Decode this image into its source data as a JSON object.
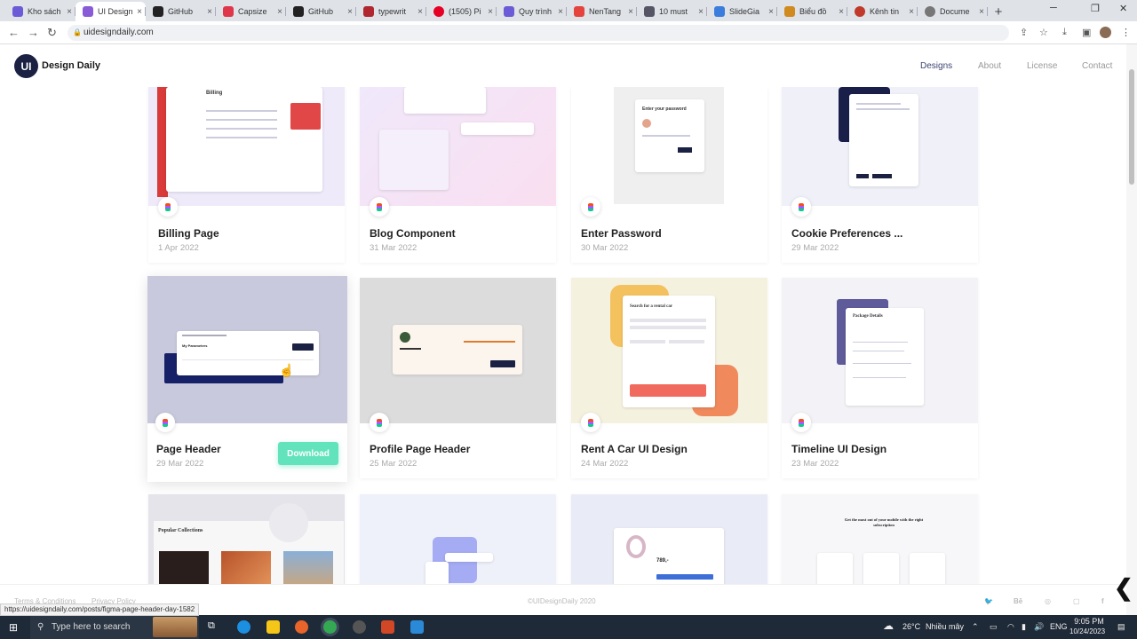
{
  "browser": {
    "tabs": [
      {
        "label": "Kho sách",
        "color": "#6b5bd6"
      },
      {
        "label": "UI Design",
        "color": "#8a5bd6"
      },
      {
        "label": "GitHub",
        "color": "#222222"
      },
      {
        "label": "Capsize",
        "color": "#e0364b"
      },
      {
        "label": "GitHub",
        "color": "#222222"
      },
      {
        "label": "typewrit",
        "color": "#b0272f"
      },
      {
        "label": "(1505) Pi",
        "color": "#e60023"
      },
      {
        "label": "Quy trình",
        "color": "#6b5bd6"
      },
      {
        "label": "NenTang",
        "color": "#e5433d"
      },
      {
        "label": "10 must",
        "color": "#555566"
      },
      {
        "label": "SlideGia",
        "color": "#3b7ddd"
      },
      {
        "label": "Biểu đồ",
        "color": "#d08a1e"
      },
      {
        "label": "Kênh tin",
        "color": "#c0392b"
      },
      {
        "label": "Docume",
        "color": "#777777"
      }
    ],
    "url": "uidesigndaily.com",
    "status_url": "https://uidesigndaily.com/posts/figma-page-header-day-1582"
  },
  "site": {
    "logo": "UI",
    "brand": "Design Daily",
    "nav": [
      "Designs",
      "About",
      "License",
      "Contact"
    ]
  },
  "cards": [
    {
      "title": "Billing Page",
      "date": "1 Apr 2022",
      "bg": "#eeeafa"
    },
    {
      "title": "Blog Component",
      "date": "31 Mar 2022",
      "bg": "#f6e6f3"
    },
    {
      "title": "Enter Password",
      "date": "30 Mar 2022",
      "bg": "#ffffff"
    },
    {
      "title": "Cookie Preferences ...",
      "date": "29 Mar 2022",
      "bg": "#eff0f8"
    },
    {
      "title": "Page Header",
      "date": "29 Mar 2022",
      "bg": "#c8c9dc",
      "download": "Download"
    },
    {
      "title": "Profile Page Header",
      "date": "25 Mar 2022",
      "bg": "#dcdcdc"
    },
    {
      "title": "Rent A Car UI Design",
      "date": "24 Mar 2022",
      "bg": "#f5f1df"
    },
    {
      "title": "Timeline UI Design",
      "date": "23 Mar 2022",
      "bg": "#f3f3f7"
    },
    {
      "title": "",
      "date": "",
      "bg": "#e4e4ea"
    },
    {
      "title": "",
      "date": "",
      "bg": "#eef0fa"
    },
    {
      "title": "",
      "date": "",
      "bg": "#e9ebf6"
    },
    {
      "title": "",
      "date": "",
      "bg": "#f7f7f9"
    }
  ],
  "previews": {
    "popular": "Popular Collections",
    "search_car": "Search for a rental car",
    "package": "Package Details",
    "enter_pw": "Enter your password",
    "billing": "Billing",
    "price": "789,-",
    "mobile_head": "Get the most out of your mobile with the right subscription"
  },
  "footer": {
    "terms": "Terms & Conditions",
    "privacy": "Privacy Policy",
    "copyright": "©UIDesignDaily 2020"
  },
  "taskbar": {
    "search": "Type here to search",
    "weather": "26°C",
    "weather_desc": "Nhiều mây",
    "lang": "ENG",
    "time": "9:05 PM",
    "date": "10/24/2023"
  }
}
